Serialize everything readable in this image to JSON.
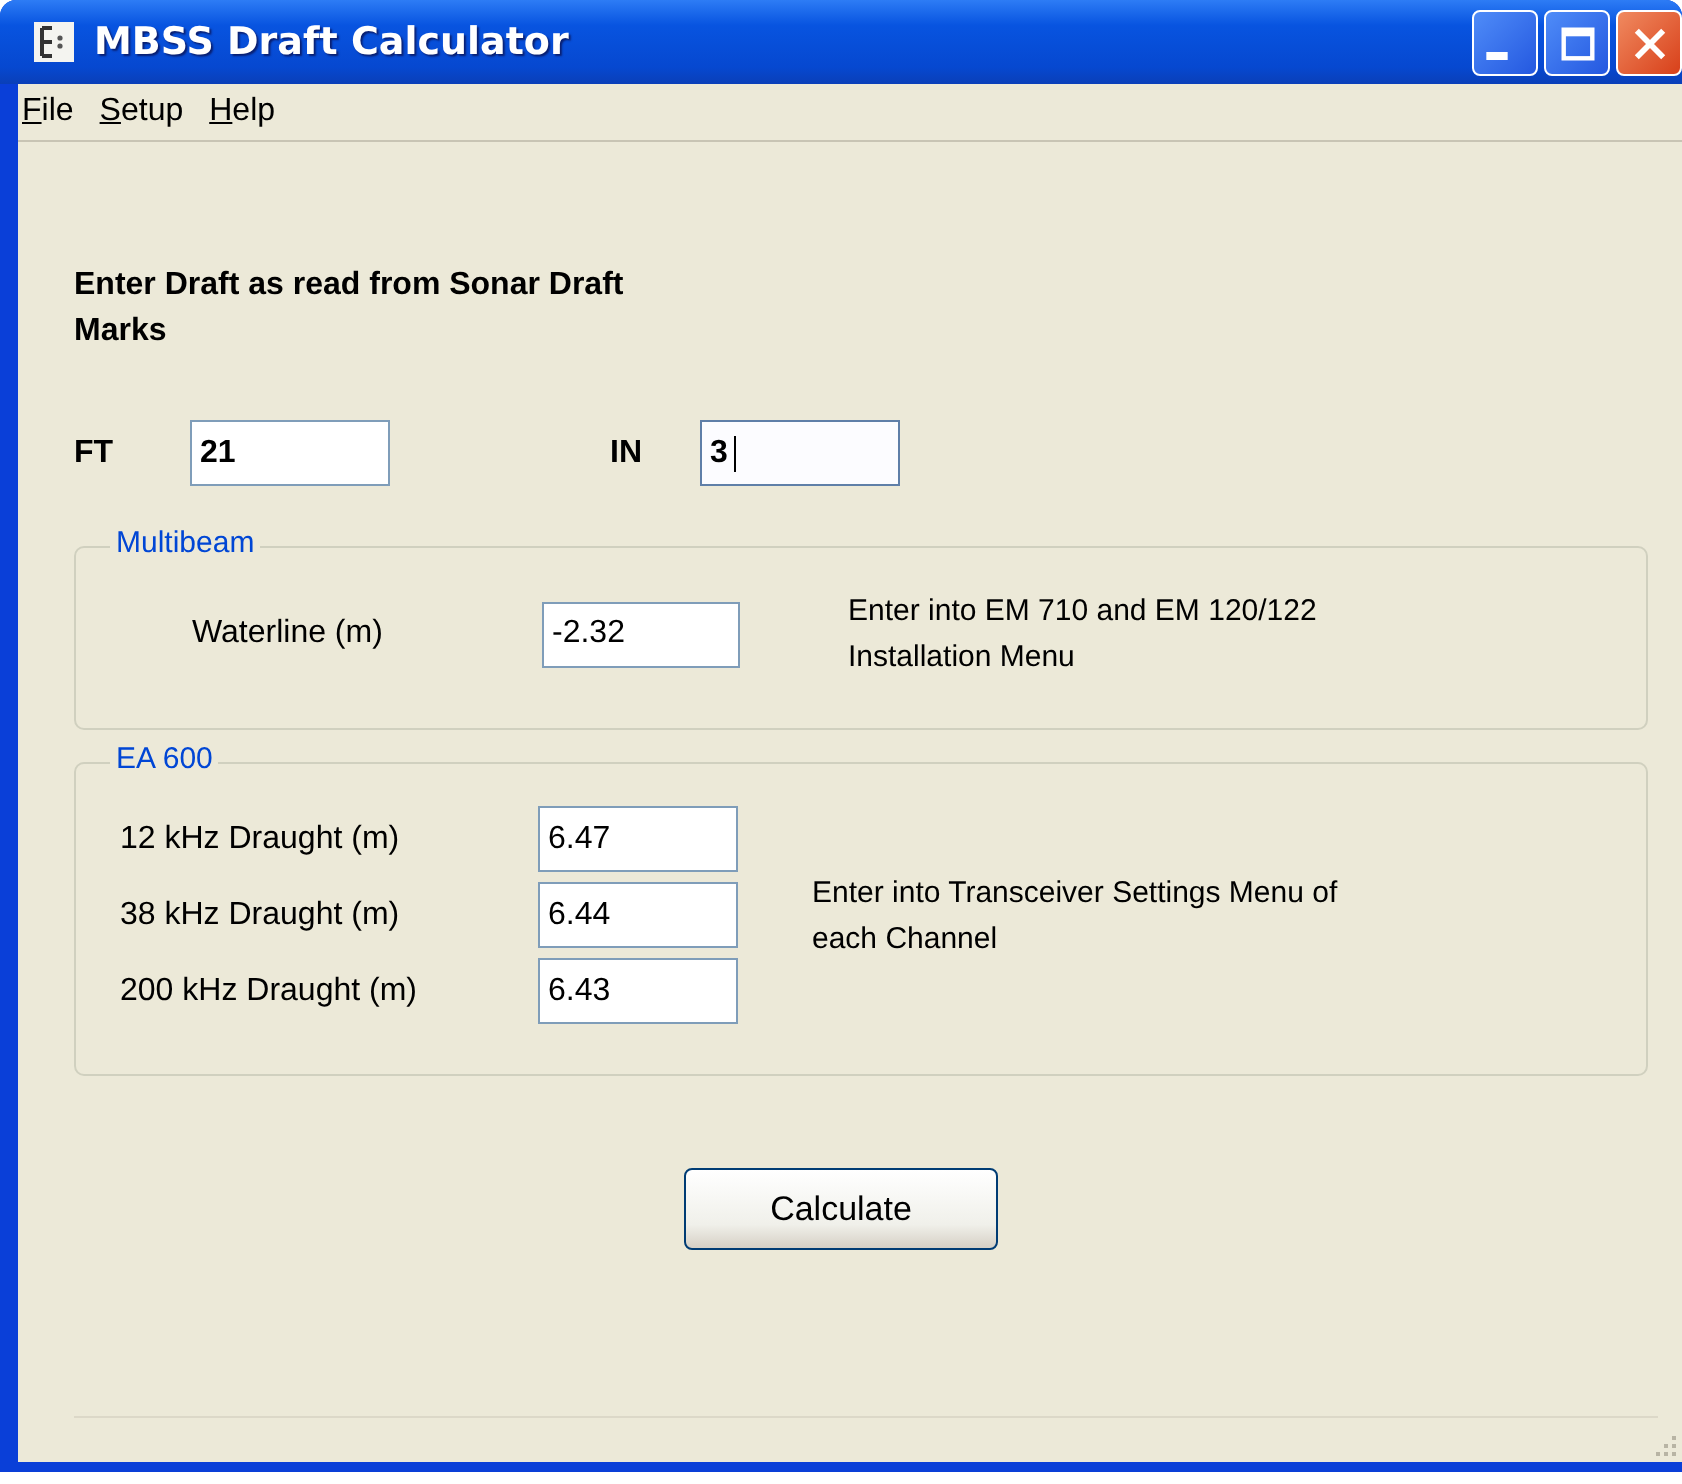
{
  "window": {
    "title": "MBSS Draft Calculator"
  },
  "menu": [
    {
      "label": "File"
    },
    {
      "label": "Setup"
    },
    {
      "label": "Help"
    }
  ],
  "instruction": "Enter Draft as read from Sonar Draft Marks",
  "draft": [
    {
      "label": "FT",
      "value": "21",
      "focused": false
    },
    {
      "label": "IN",
      "value": "3",
      "focused": true
    }
  ],
  "groups": [
    {
      "title": "Multibeam",
      "fields": [
        {
          "label": "Waterline (m)",
          "value": "-2.32"
        }
      ],
      "note": "Enter into EM 710 and EM 120/122 Installation Menu"
    },
    {
      "title": "EA 600",
      "fields": [
        {
          "label": "12 kHz Draught (m)",
          "value": "6.47"
        },
        {
          "label": "38 kHz Draught (m)",
          "value": "6.44"
        },
        {
          "label": "200 kHz Draught (m)",
          "value": "6.43"
        }
      ],
      "note": "Enter into Transceiver Settings Menu of each Channel"
    }
  ],
  "button": "Calculate"
}
